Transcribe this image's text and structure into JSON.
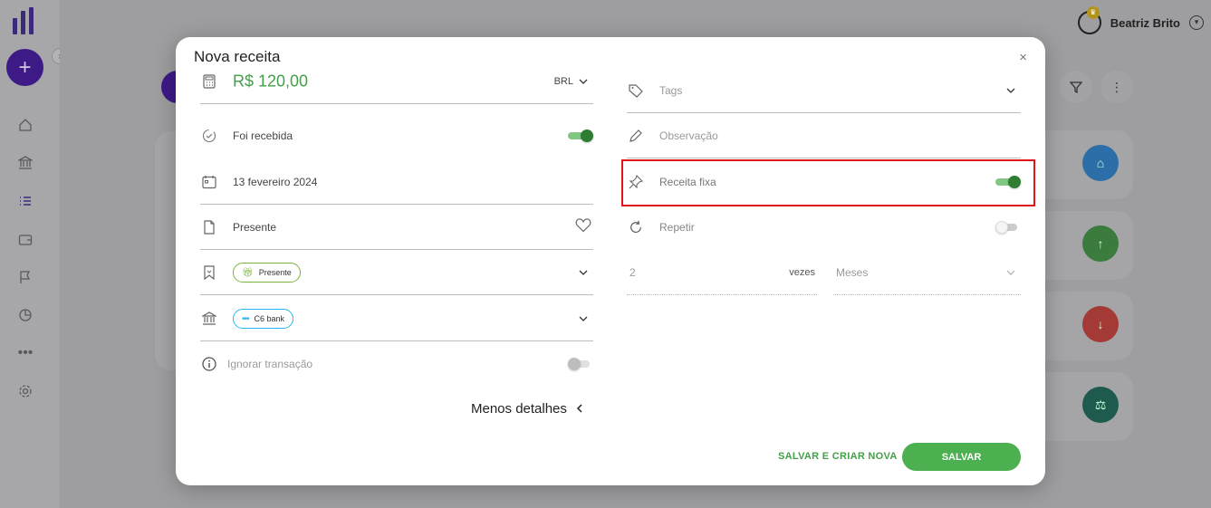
{
  "user": {
    "name": "Beatriz Brito"
  },
  "modal": {
    "title": "Nova receita",
    "close_label": "×",
    "left": {
      "amount": "R$ 120,00",
      "currency": "BRL",
      "received_label": "Foi recebida",
      "received_on": true,
      "date": "13 fevereiro 2024",
      "description": "Presente",
      "category": "Presente",
      "account": "C6 bank",
      "ignore_label": "Ignorar transação",
      "ignore_on": false
    },
    "right": {
      "tags_placeholder": "Tags",
      "note_placeholder": "Observação",
      "fixed_label": "Receita fixa",
      "fixed_on": true,
      "repeat_label": "Repetir",
      "repeat_on": false,
      "repeat_count": "2",
      "repeat_unit": "vezes",
      "period": "Meses"
    },
    "less_details": "Menos detalhes",
    "save_new_label": "SALVAR E CRIAR NOVA",
    "save_label": "SALVAR"
  },
  "colors": {
    "accent": "#4caf50",
    "highlight": "#e0151b",
    "brand": "#3e1a86"
  }
}
